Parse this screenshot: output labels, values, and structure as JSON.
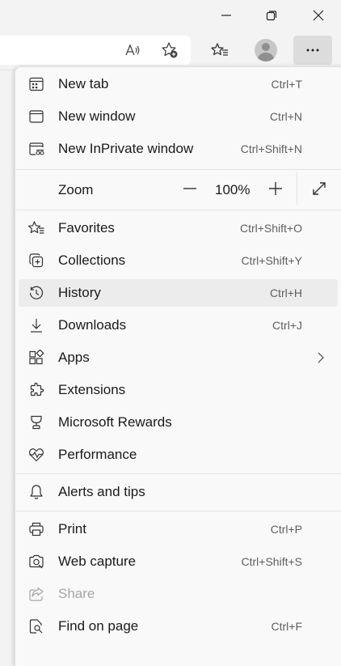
{
  "menu": {
    "items": [
      {
        "label": "New tab",
        "shortcut": "Ctrl+T"
      },
      {
        "label": "New window",
        "shortcut": "Ctrl+N"
      },
      {
        "label": "New InPrivate window",
        "shortcut": "Ctrl+Shift+N"
      },
      {
        "label": "Favorites",
        "shortcut": "Ctrl+Shift+O"
      },
      {
        "label": "Collections",
        "shortcut": "Ctrl+Shift+Y"
      },
      {
        "label": "History",
        "shortcut": "Ctrl+H"
      },
      {
        "label": "Downloads",
        "shortcut": "Ctrl+J"
      },
      {
        "label": "Apps",
        "shortcut": ""
      },
      {
        "label": "Extensions",
        "shortcut": ""
      },
      {
        "label": "Microsoft Rewards",
        "shortcut": ""
      },
      {
        "label": "Performance",
        "shortcut": ""
      },
      {
        "label": "Alerts and tips",
        "shortcut": ""
      },
      {
        "label": "Print",
        "shortcut": "Ctrl+P"
      },
      {
        "label": "Web capture",
        "shortcut": "Ctrl+Shift+S"
      },
      {
        "label": "Share",
        "shortcut": ""
      },
      {
        "label": "Find on page",
        "shortcut": "Ctrl+F"
      }
    ],
    "zoom": {
      "label": "Zoom",
      "value": "100%"
    }
  },
  "colors": {
    "menu_bg": "#f9f9f9",
    "hover": "#ececec",
    "shortcut": "#5f5f5f",
    "disabled": "#a6a6a6",
    "window_bg": "#f3f3f3"
  },
  "icons": {
    "caption": [
      "minimize-icon",
      "restore-icon",
      "close-icon"
    ],
    "toolbar": [
      "read-aloud-icon",
      "add-favorite-icon",
      "favorites-icon",
      "profile-avatar-icon",
      "more-options-icon"
    ]
  }
}
